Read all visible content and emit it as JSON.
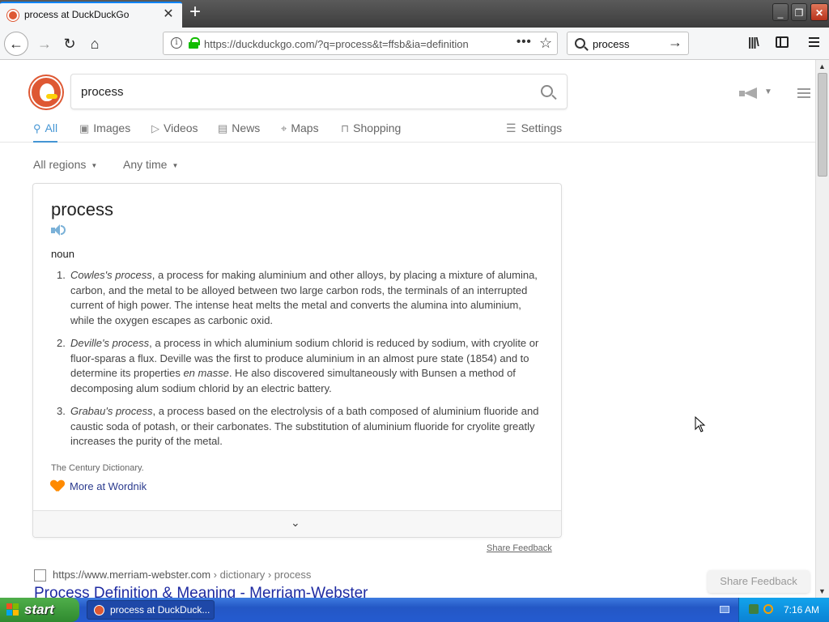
{
  "browser": {
    "tab_title": "process at DuckDuckGo",
    "url": "https://duckduckgo.com/?q=process&t=ffsb&ia=definition",
    "search_value": "process",
    "new_tab_symbol": "+",
    "window_controls": {
      "minimize": "_",
      "maximize": "❐",
      "close": "✕"
    }
  },
  "search": {
    "query": "process"
  },
  "tabs": [
    {
      "label": "All",
      "icon": "search-icon",
      "active": true
    },
    {
      "label": "Images",
      "icon": "image-icon"
    },
    {
      "label": "Videos",
      "icon": "play-icon"
    },
    {
      "label": "News",
      "icon": "newspaper-icon"
    },
    {
      "label": "Maps",
      "icon": "map-pin-icon"
    },
    {
      "label": "Shopping",
      "icon": "shopping-bag-icon"
    }
  ],
  "settings_label": "Settings",
  "filters": {
    "region": "All regions",
    "time": "Any time"
  },
  "definition": {
    "word": "process",
    "part_of_speech": "noun",
    "entries": [
      {
        "num": "1.",
        "term": "Cowles's process",
        "text_a": ", a process for making aluminium and other alloys, by placing a mixture of alumina, carbon, and the metal to be alloyed between two large carbon rods, the terminals of an interrupted current of high power. The intense heat melts the metal and converts the alumina into aluminium, while the oxygen escapes as carbonic oxid."
      },
      {
        "num": "2.",
        "term": "Deville's process",
        "text_a": ", a process in which aluminium sodium chlorid is reduced by sodium, with cryolite or fluor-sparas a flux. Deville was the first to produce aluminium in an almost pure state (1854) and to determine its properties ",
        "emph": "en masse",
        "text_b": ". He also discovered simultaneously with Bunsen a method of decomposing alum sodium chlorid by an electric battery."
      },
      {
        "num": "3.",
        "term": "Grabau's process",
        "text_a": ", a process based on the electrolysis of a bath composed of aluminium fluoride and caustic soda of potash, or their carbonates. The substitution of aluminium fluoride for cryolite greatly increases the purity of the metal."
      }
    ],
    "source": "The Century Dictionary.",
    "more_link": "More at Wordnik"
  },
  "share_feedback": "Share Feedback",
  "result": {
    "url": "https://www.merriam-webster.com",
    "breadcrumb": "› dictionary › process",
    "title": "Process Definition & Meaning - Merriam-Webster"
  },
  "floating_feedback": "Share Feedback",
  "taskbar": {
    "start_label": "start",
    "task_title": "process at DuckDuck...",
    "clock": "7:16 AM"
  },
  "colors": {
    "accent_blue": "#4495d4",
    "ddg_orange": "#de5833",
    "result_title": "#1d29a1",
    "link_color": "#2b3b8e"
  }
}
